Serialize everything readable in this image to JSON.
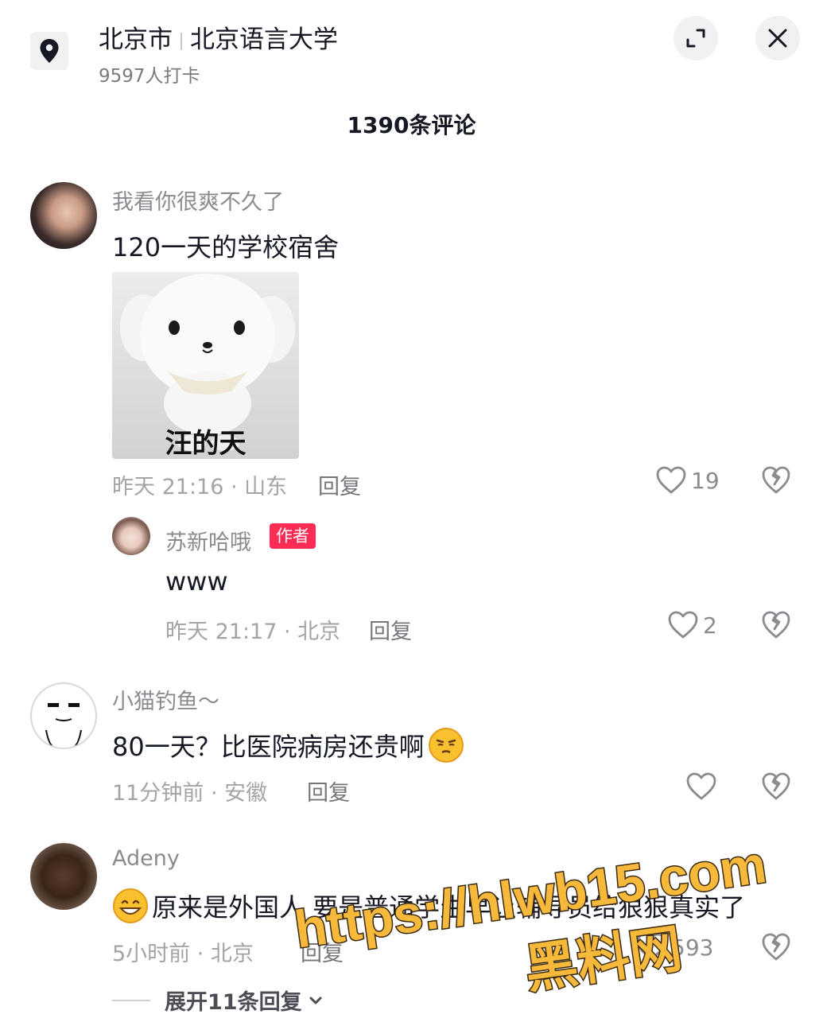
{
  "header": {
    "city": "北京市",
    "place": "北京语言大学",
    "checkins": "9597人打卡",
    "pin_icon": "location-pin-icon",
    "expand_icon": "expand-icon",
    "close_icon": "close-icon"
  },
  "comments_title": "1390条评论",
  "comments": [
    {
      "user": "我看你很爽不久了",
      "text": "120一天的学校宿舍",
      "sticker_caption": "汪的天",
      "meta": "昨天 21:16 · 山东",
      "reply_label": "回复",
      "likes": "19",
      "replies": [
        {
          "user": "苏新哈哦",
          "badge": "作者",
          "text": "www",
          "meta": "昨天 21:17 · 北京",
          "reply_label": "回复",
          "likes": "2"
        }
      ]
    },
    {
      "user": "小猫钓鱼～",
      "text": "80一天？比医院病房还贵啊",
      "meta": "11分钟前 · 安徽",
      "reply_label": "回复",
      "likes": ""
    },
    {
      "user": "Adeny",
      "text": "原来是外国人 要是普通学生早让辅导员给狠狠真实了",
      "meta": "5小时前 · 北京",
      "reply_label": "回复",
      "likes": "593"
    }
  ],
  "expand_replies": "展开11条回复",
  "watermark": {
    "line1": "https://hlwb15.com",
    "line2": "黑料网"
  },
  "colors": {
    "accent": "#fe2c55",
    "watermark_fill": "#f6b93b",
    "watermark_stroke": "#3a2a10"
  }
}
